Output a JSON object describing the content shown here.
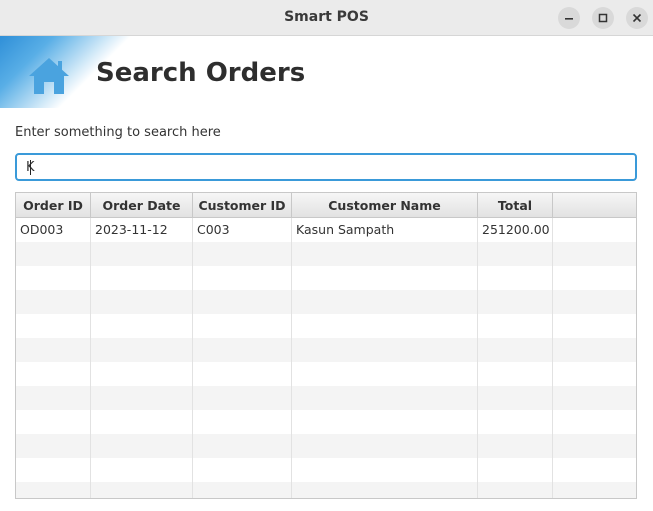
{
  "window": {
    "title": "Smart POS",
    "controls": [
      "minimize-icon",
      "maximize-icon",
      "close-icon"
    ]
  },
  "header": {
    "title": "Search Orders",
    "icon": "home-icon",
    "accent": "#3a9ad9"
  },
  "search": {
    "hint": "Enter something to search here",
    "value": "K"
  },
  "table": {
    "columns": [
      "Order ID",
      "Order Date",
      "Customer ID",
      "Customer Name",
      "Total"
    ],
    "rows": [
      [
        "OD003",
        "2023-11-12",
        "C003",
        "Kasun Sampath",
        "251200.00"
      ]
    ]
  }
}
